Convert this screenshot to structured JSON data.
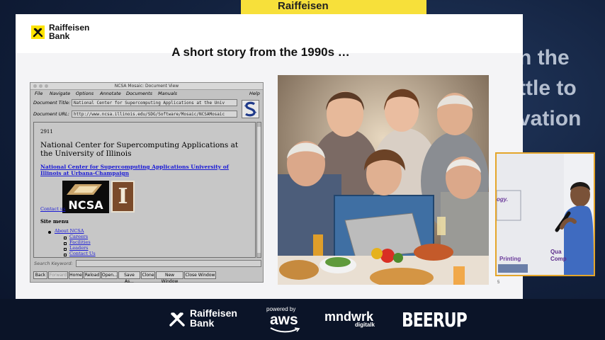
{
  "stage": {
    "banner_text": "Raiffeisen",
    "right_text_lines": [
      "n the",
      "ttle to",
      "vation"
    ]
  },
  "slide": {
    "logo_line1": "Raiffeisen",
    "logo_line2": "Bank",
    "title": "A short story from the 1990s …",
    "page_number": "5"
  },
  "mosaic": {
    "window_title": "NCSA Mosaic: Document View",
    "menu": [
      "File",
      "Navigate",
      "Options",
      "Annotate",
      "Documents",
      "Manuals",
      "Help"
    ],
    "doc_title_label": "Document Title:",
    "doc_title_value": "National Center for Supercomputing Applications at the Univ",
    "doc_url_label": "Document URL:",
    "doc_url_value": "http://www.ncsa.illinois.edu/SDG/Software/Mosaic/NCSAMosaic",
    "page_number": "2911",
    "heading": "National Center for Supercomputing Applications at the University of Illinois",
    "link": "National Center for Supercomputing Applications University of Illinois at Urbana-Champaign",
    "ncsa_logo_text": "NCSA",
    "illinois_logo_text": "I",
    "contact_link": "Contact us",
    "site_menu_label": "Site menu",
    "site_menu_items": [
      "About NCSA",
      "Careers",
      "Facilities",
      "Leaders",
      "Contact Us"
    ],
    "search_label": "Search Keyword:",
    "buttons": [
      "Back",
      "Forward",
      "Home",
      "Reload",
      "Open...",
      "Save As...",
      "Clone",
      "New Window",
      "Close Window"
    ]
  },
  "speaker": {
    "screen_text_1": "Printing",
    "screen_text_2a": "Qua",
    "screen_text_2b": "Comp",
    "screen_text_3": "ogy."
  },
  "sponsors": {
    "raiffeisen_line1": "Raiffeisen",
    "raiffeisen_line2": "Bank",
    "aws_prefix": "powered by",
    "aws": "aws",
    "mindwork": "mndwrk",
    "mindwork_sub": "digitalk",
    "beerup": "BEERUP"
  },
  "colors": {
    "raiffeisen_yellow": "#fce300",
    "speaker_frame": "#e4a52a",
    "link_blue": "#1a1ad6"
  }
}
